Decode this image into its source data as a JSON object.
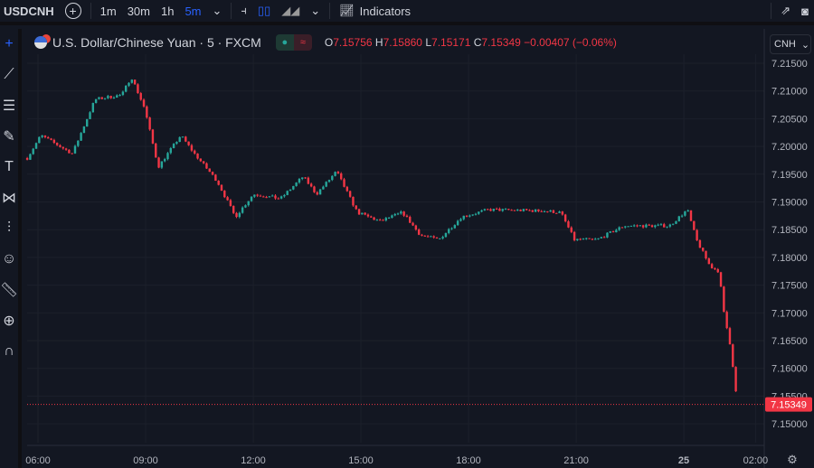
{
  "toolbar": {
    "symbol": "USDCNH",
    "intervals": [
      "1m",
      "30m",
      "1h",
      "5m"
    ],
    "active_interval": "5m",
    "indicators_label": "Indicators"
  },
  "legend": {
    "title": "U.S. Dollar/Chinese Yuan · 5 · FXCM",
    "o_label": "O",
    "o": "7.15756",
    "h_label": "H",
    "h": "7.15860",
    "l_label": "L",
    "l": "7.15171",
    "c_label": "C",
    "c": "7.15349",
    "change": "−0.00407 (−0.06%)"
  },
  "currency_select": "CNH",
  "colors": {
    "up": "#26a69a",
    "down": "#f23645",
    "bg": "#131722",
    "accent": "#2962ff"
  },
  "chart_data": {
    "type": "candlestick",
    "y_ticks": [
      "7.21500",
      "7.21000",
      "7.20500",
      "7.20000",
      "7.19500",
      "7.19000",
      "7.18500",
      "7.18000",
      "7.17500",
      "7.17000",
      "7.16500",
      "7.16000",
      "7.15500",
      "7.15000"
    ],
    "ylim": [
      7.15,
      7.215
    ],
    "x_ticks": [
      {
        "label": "06:00",
        "t": 0
      },
      {
        "label": "09:00",
        "t": 3
      },
      {
        "label": "12:00",
        "t": 6
      },
      {
        "label": "15:00",
        "t": 9
      },
      {
        "label": "18:00",
        "t": 12
      },
      {
        "label": "21:00",
        "t": 15
      },
      {
        "label": "25",
        "t": 18
      },
      {
        "label": "02:00",
        "t": 20
      }
    ],
    "last_price": "7.15349",
    "last_value": 7.15349,
    "price_path_hours_from_0600": [
      [
        -0.3,
        7.1979
      ],
      [
        0.08,
        7.202
      ],
      [
        0.96,
        7.1987
      ],
      [
        1.59,
        7.2085
      ],
      [
        2.34,
        7.2093
      ],
      [
        2.6,
        7.2126
      ],
      [
        2.97,
        7.2069
      ],
      [
        3.35,
        7.1963
      ],
      [
        3.98,
        7.202
      ],
      [
        4.36,
        7.1987
      ],
      [
        4.99,
        7.1938
      ],
      [
        5.5,
        7.1873
      ],
      [
        6.0,
        7.1914
      ],
      [
        6.76,
        7.1906
      ],
      [
        7.39,
        7.1946
      ],
      [
        7.76,
        7.1914
      ],
      [
        8.32,
        7.1955
      ],
      [
        8.9,
        7.1881
      ],
      [
        9.53,
        7.1865
      ],
      [
        10.16,
        7.1881
      ],
      [
        10.66,
        7.184
      ],
      [
        11.17,
        7.1832
      ],
      [
        11.8,
        7.1873
      ],
      [
        12.55,
        7.1886
      ],
      [
        14.07,
        7.1884
      ],
      [
        14.57,
        7.1881
      ],
      [
        14.95,
        7.1832
      ],
      [
        15.58,
        7.1832
      ],
      [
        16.33,
        7.1857
      ],
      [
        17.6,
        7.1857
      ],
      [
        18.1,
        7.1886
      ],
      [
        18.35,
        7.1832
      ],
      [
        18.73,
        7.1784
      ],
      [
        18.98,
        7.1775
      ],
      [
        19.11,
        7.1702
      ],
      [
        19.31,
        7.1637
      ],
      [
        19.49,
        7.1535
      ]
    ]
  }
}
